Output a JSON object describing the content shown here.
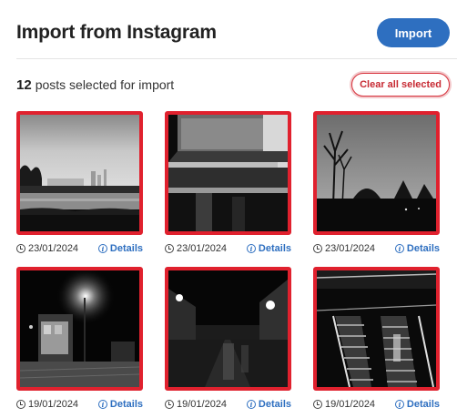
{
  "header": {
    "title": "Import from Instagram",
    "import_label": "Import"
  },
  "selection": {
    "count": "12",
    "text": "posts selected for import",
    "clear_label": "Clear all selected"
  },
  "posts": [
    {
      "date": "23/01/2024",
      "details_label": "Details",
      "image": "park-lake-skyline",
      "selected": true
    },
    {
      "date": "23/01/2024",
      "details_label": "Details",
      "image": "concrete-steps-wall",
      "selected": true
    },
    {
      "date": "23/01/2024",
      "details_label": "Details",
      "image": "bare-trees-sky",
      "selected": true
    },
    {
      "date": "19/01/2024",
      "details_label": "Details",
      "image": "night-street-kiosk",
      "selected": true
    },
    {
      "date": "19/01/2024",
      "details_label": "Details",
      "image": "night-city-street",
      "selected": true
    },
    {
      "date": "19/01/2024",
      "details_label": "Details",
      "image": "escalators",
      "selected": true
    }
  ],
  "colors": {
    "accent": "#2e6fc0",
    "selected_border": "#e0212e",
    "clear_border": "#d6303a"
  },
  "icons": {
    "date": "clock-icon",
    "details": "info-icon"
  }
}
